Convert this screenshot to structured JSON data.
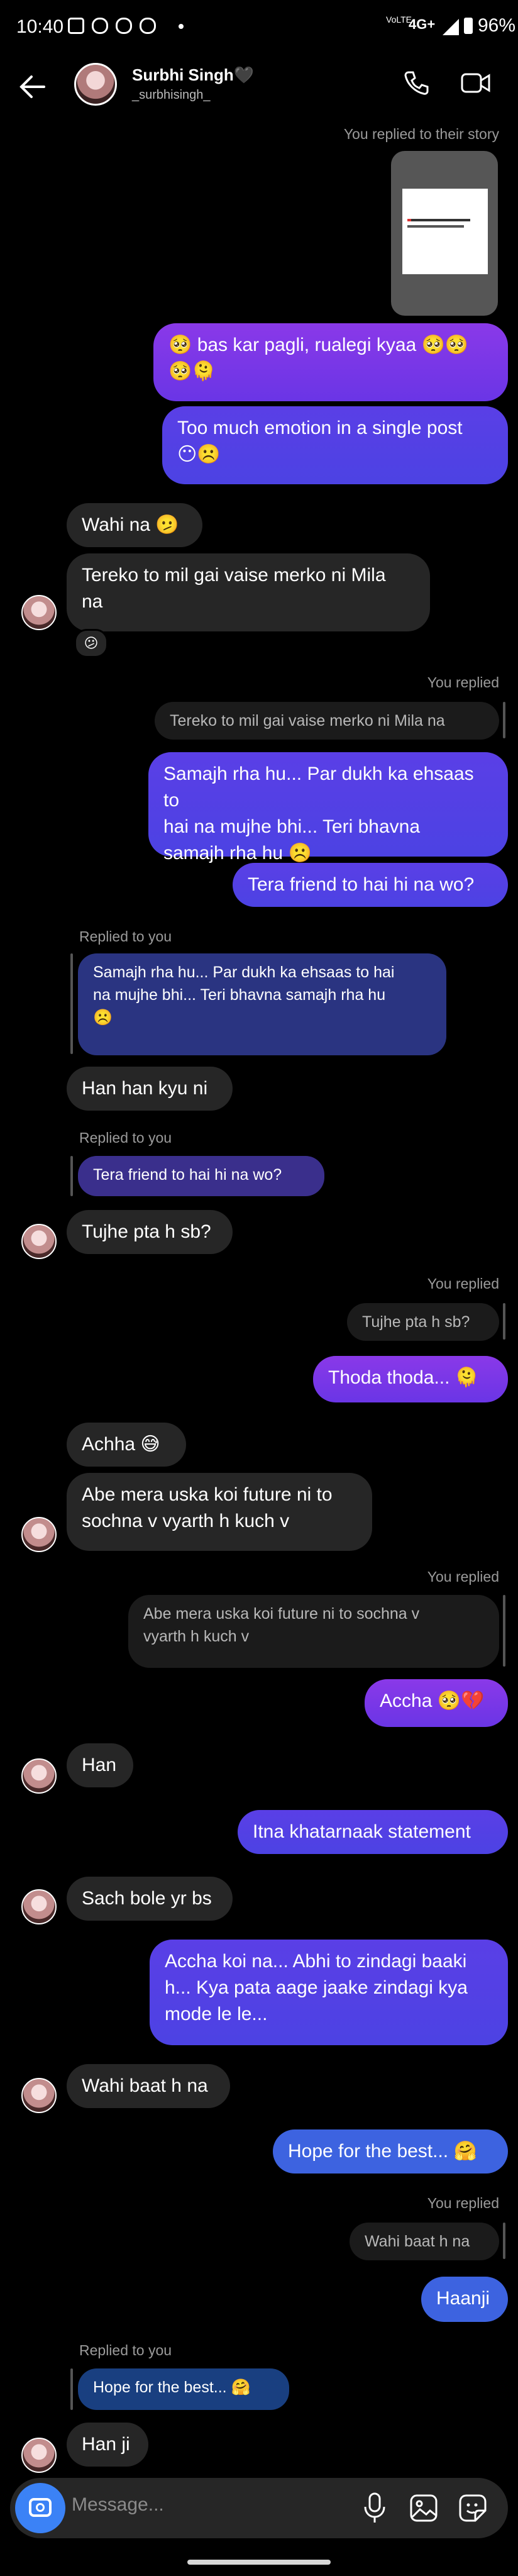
{
  "status_bar": {
    "time": "10:40",
    "network_top": "VoLTE",
    "network_type": "4G+",
    "battery": "96%"
  },
  "header": {
    "back_icon": "arrow-left-icon",
    "name": "Surbhi Singh🖤",
    "username": "_surbhisingh_",
    "call_icon": "phone-icon",
    "video_icon": "video-camera-icon"
  },
  "messages": {
    "story_reply_label": "You replied to their story",
    "o1": "🥺 bas kar pagli, rualegi kyaa 🥺🥺\n🥺🫠",
    "o2": "Too much emotion in a single post\n😶☹️",
    "i1": "Wahi na 🫤",
    "i2": "Tereko to mil gai vaise merko ni Mila\nna",
    "i2_reaction": "😕",
    "you_replied_1": "You replied",
    "q1": "Tereko to mil gai vaise merko ni Mila na",
    "o3": "Samajh rha hu... Par dukh ka ehsaas to\nhai na mujhe bhi... Teri bhavna\nsamajh rha hu ☹️",
    "o4": "Tera friend to hai hi na wo?",
    "replied_to_you_1": "Replied to you",
    "q2": "Samajh rha hu... Par dukh ka ehsaas to hai\nna mujhe bhi... Teri bhavna samajh rha hu\n☹️",
    "i3": "Han han kyu ni",
    "replied_to_you_2": "Replied to you",
    "q3": "Tera friend to hai hi na wo?",
    "i4": "Tujhe pta h sb?",
    "you_replied_2": "You replied",
    "q4": "Tujhe pta h sb?",
    "o5": "Thoda thoda... 🫠",
    "i5": "Achha 😅",
    "i6": "Abe mera uska koi future ni to\nsochna v vyarth h kuch v",
    "you_replied_3": "You replied",
    "q5": "Abe mera uska koi future ni to sochna v\nvyarth h kuch v",
    "o6": "Accha 🥺💔",
    "i7": "Han",
    "o7": "Itna khatarnaak statement",
    "i8": "Sach bole yr bs",
    "o8": "Accha koi na... Abhi to zindagi baaki\nh... Kya pata aage jaake zindagi kya\nmode le le...",
    "i9": "Wahi baat h na",
    "o9": "Hope for the best... 🤗",
    "you_replied_4": "You replied",
    "q6": "Wahi baat h na",
    "o10": "Haanji",
    "replied_to_you_3": "Replied to you",
    "q7": "Hope for the best... 🤗",
    "i10": "Han ji"
  },
  "composer": {
    "placeholder": "Message...",
    "camera_icon": "camera-icon",
    "mic_icon": "microphone-icon",
    "gallery_icon": "gallery-icon",
    "sticker_icon": "sticker-icon"
  },
  "colors": {
    "background": "#000000",
    "incoming": "#262626",
    "outgoing_purple": "#7b37e7",
    "outgoing_blue": "#3d63e0",
    "accent": "#3b82f6"
  }
}
